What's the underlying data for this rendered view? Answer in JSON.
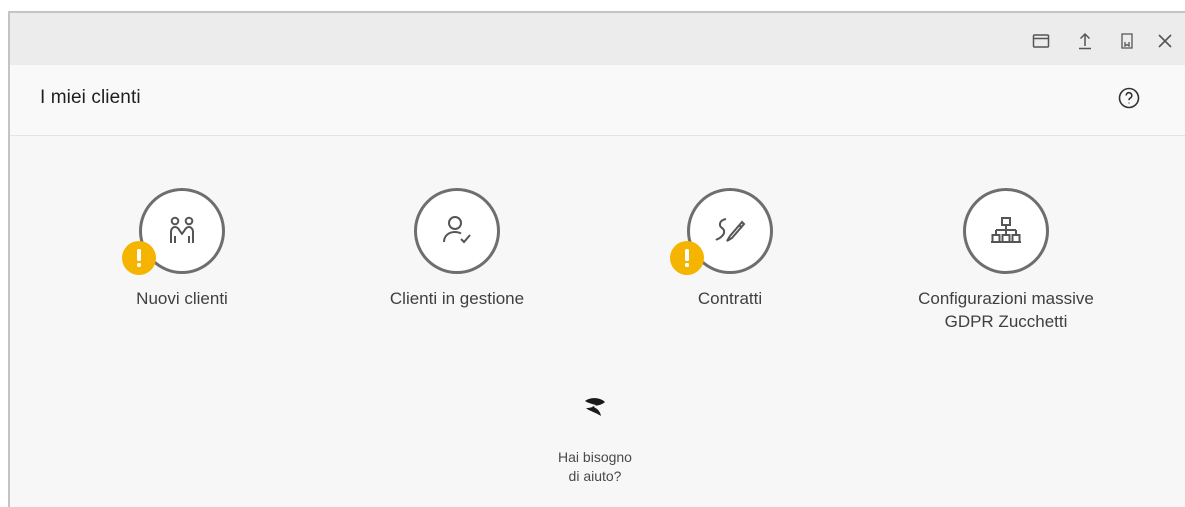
{
  "window": {
    "controls": [
      {
        "name": "maximize-icon"
      },
      {
        "name": "upload-icon"
      },
      {
        "name": "bookmark-icon"
      },
      {
        "name": "close-icon"
      }
    ]
  },
  "header": {
    "title": "I miei clienti",
    "help_icon": "question-circle-icon"
  },
  "tiles": [
    {
      "label": "Nuovi clienti",
      "icon": "people-icon",
      "warning": true
    },
    {
      "label": "Clienti in gestione",
      "icon": "user-check-icon",
      "warning": false
    },
    {
      "label": "Contratti",
      "icon": "signature-icon",
      "warning": true
    },
    {
      "label_line1": "Configurazioni massive",
      "label_line2": "GDPR Zucchetti",
      "icon": "hierarchy-icon",
      "warning": false
    }
  ],
  "help": {
    "line1": "Hai bisogno",
    "line2": "di aiuto?",
    "logo": "zucchetti-logo"
  },
  "colors": {
    "warning_badge": "#f5b400",
    "icon_stroke": "#6e6e6e",
    "titlebar": "#ececec"
  }
}
